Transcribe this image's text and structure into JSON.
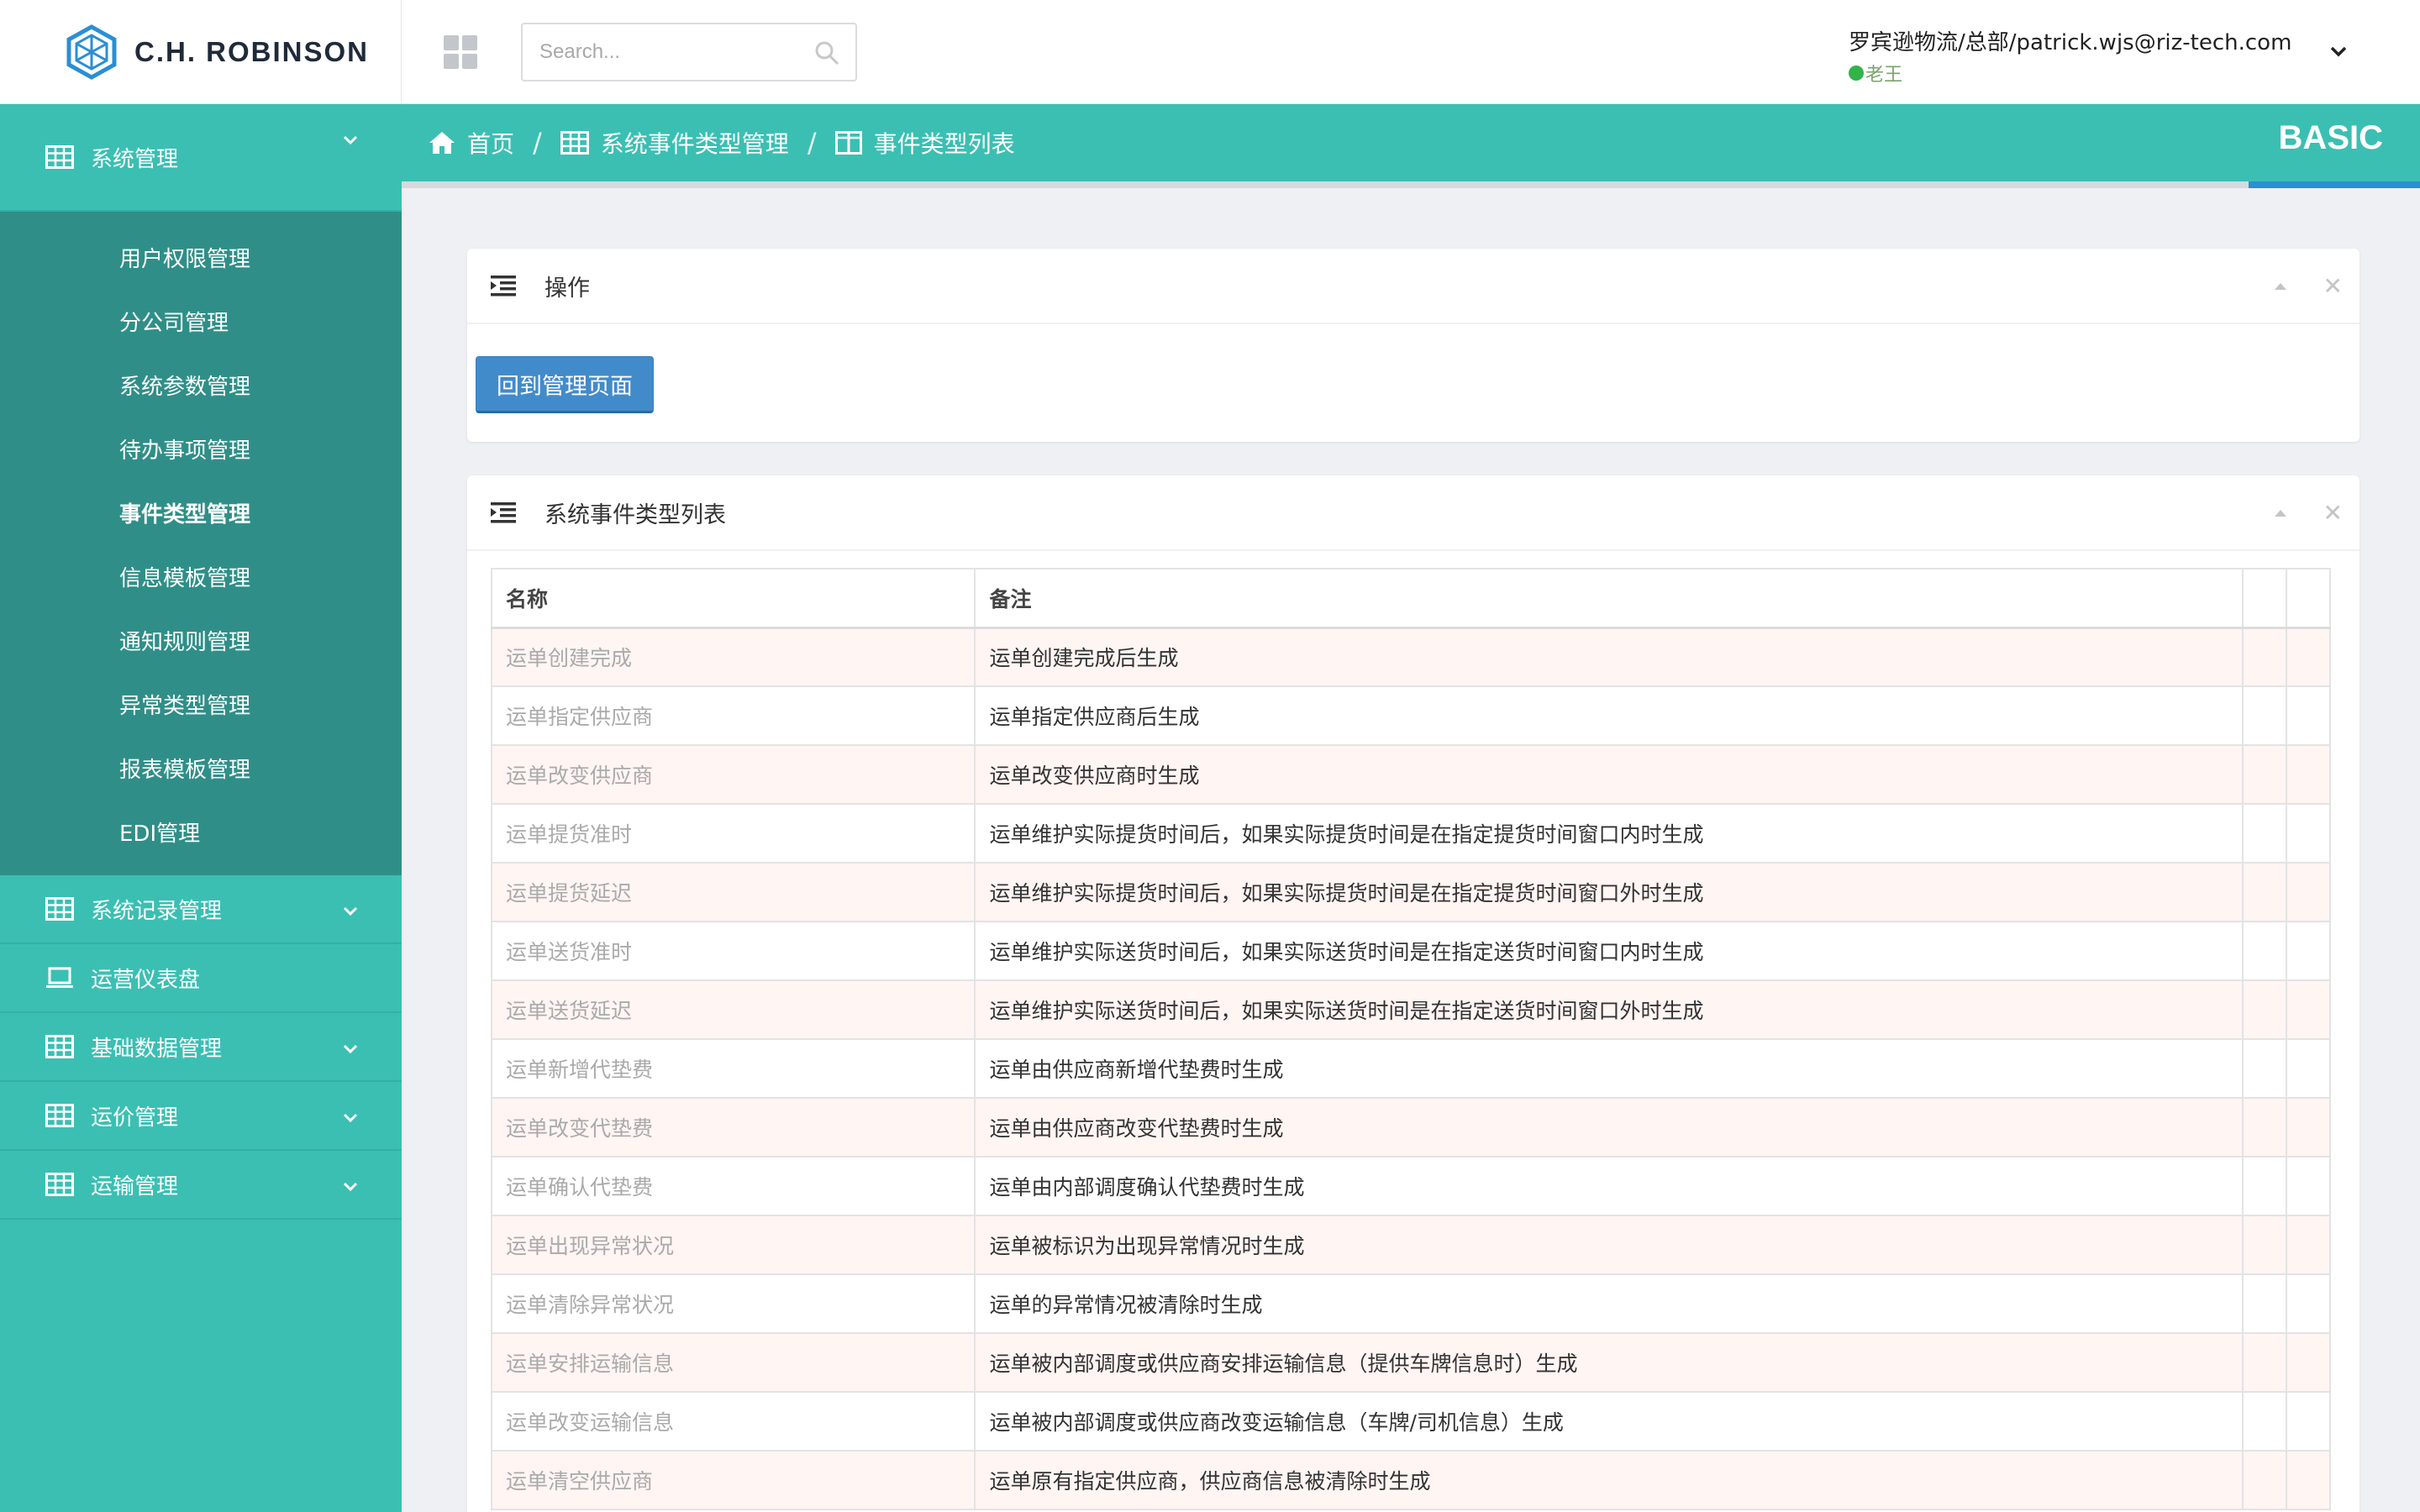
{
  "brand": {
    "name": "C.H. ROBINSON"
  },
  "search": {
    "placeholder": "Search..."
  },
  "user": {
    "name": "罗宾逊物流/总部/patrick.wjs@riz-tech.com",
    "status": "老王"
  },
  "sidebar": {
    "groups": [
      {
        "label": "系统管理",
        "icon": "table-icon",
        "expanded": true
      },
      {
        "label": "系统记录管理",
        "icon": "table-icon"
      },
      {
        "label": "运营仪表盘",
        "icon": "laptop-icon"
      },
      {
        "label": "基础数据管理",
        "icon": "table-icon"
      },
      {
        "label": "运价管理",
        "icon": "table-icon"
      },
      {
        "label": "运输管理",
        "icon": "table-icon"
      }
    ],
    "submenu": [
      {
        "label": "用户权限管理"
      },
      {
        "label": "分公司管理"
      },
      {
        "label": "系统参数管理"
      },
      {
        "label": "待办事项管理"
      },
      {
        "label": "事件类型管理",
        "active": true
      },
      {
        "label": "信息模板管理"
      },
      {
        "label": "通知规则管理"
      },
      {
        "label": "异常类型管理"
      },
      {
        "label": "报表模板管理"
      },
      {
        "label": "EDI管理"
      }
    ]
  },
  "breadcrumb": [
    {
      "label": "首页",
      "icon": "home-icon"
    },
    {
      "label": "系统事件类型管理",
      "icon": "table-icon"
    },
    {
      "label": "事件类型列表",
      "icon": "columns-icon"
    }
  ],
  "edition": "BASIC",
  "ops_panel": {
    "title": "操作",
    "button": "回到管理页面"
  },
  "list_panel": {
    "title": "系统事件类型列表",
    "columns": [
      "名称",
      "备注",
      "",
      ""
    ],
    "rows": [
      {
        "name": "运单创建完成",
        "note": "运单创建完成后生成"
      },
      {
        "name": "运单指定供应商",
        "note": "运单指定供应商后生成"
      },
      {
        "name": "运单改变供应商",
        "note": "运单改变供应商时生成"
      },
      {
        "name": "运单提货准时",
        "note": "运单维护实际提货时间后，如果实际提货时间是在指定提货时间窗口内时生成"
      },
      {
        "name": "运单提货延迟",
        "note": "运单维护实际提货时间后，如果实际提货时间是在指定提货时间窗口外时生成"
      },
      {
        "name": "运单送货准时",
        "note": "运单维护实际送货时间后，如果实际送货时间是在指定送货时间窗口内时生成"
      },
      {
        "name": "运单送货延迟",
        "note": "运单维护实际送货时间后，如果实际送货时间是在指定送货时间窗口外时生成"
      },
      {
        "name": "运单新增代垫费",
        "note": "运单由供应商新增代垫费时生成"
      },
      {
        "name": "运单改变代垫费",
        "note": "运单由供应商改变代垫费时生成"
      },
      {
        "name": "运单确认代垫费",
        "note": "运单由内部调度确认代垫费时生成"
      },
      {
        "name": "运单出现异常状况",
        "note": "运单被标识为出现异常情况时生成"
      },
      {
        "name": "运单清除异常状况",
        "note": "运单的异常情况被清除时生成"
      },
      {
        "name": "运单安排运输信息",
        "note": "运单被内部调度或供应商安排运输信息（提供车牌信息时）生成"
      },
      {
        "name": "运单改变运输信息",
        "note": "运单被内部调度或供应商改变运输信息（车牌/司机信息）生成"
      },
      {
        "name": "运单清空供应商",
        "note": "运单原有指定供应商，供应商信息被清除时生成"
      }
    ]
  },
  "colors": {
    "teal": "#3bbfb3",
    "teal_dark": "#2f8f88",
    "primary": "#428bca",
    "accent_line": "#2a8fd4"
  }
}
